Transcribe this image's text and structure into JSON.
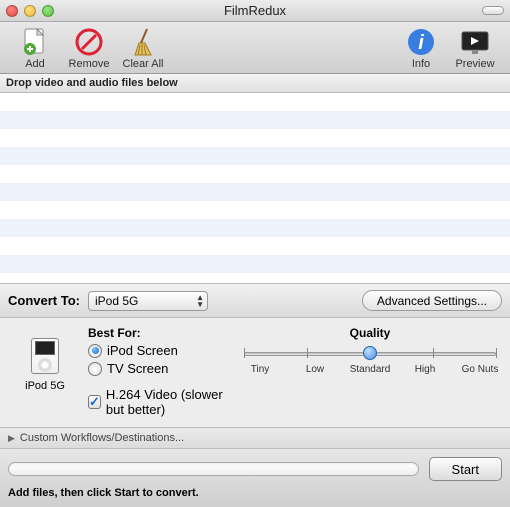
{
  "window": {
    "title": "FilmRedux"
  },
  "toolbar": {
    "add": "Add",
    "remove": "Remove",
    "clear": "Clear All",
    "info": "Info",
    "preview": "Preview"
  },
  "drop_hint": "Drop video and audio files below",
  "convert": {
    "label": "Convert To:",
    "device": "iPod 5G",
    "advanced": "Advanced Settings..."
  },
  "settings": {
    "device_label": "iPod 5G",
    "best_for": "Best For:",
    "option_ipod": "iPod Screen",
    "option_tv": "TV Screen",
    "selected": "ipod",
    "h264_checked": true,
    "h264_label": "H.264 Video (slower but better)"
  },
  "quality": {
    "header": "Quality",
    "ticks": [
      "Tiny",
      "Low",
      "Standard",
      "High",
      "Go Nuts"
    ],
    "value_index": 2
  },
  "workflows": {
    "label": "Custom Workflows/Destinations..."
  },
  "bottom": {
    "status": "Add files, then click Start to convert.",
    "start": "Start"
  }
}
